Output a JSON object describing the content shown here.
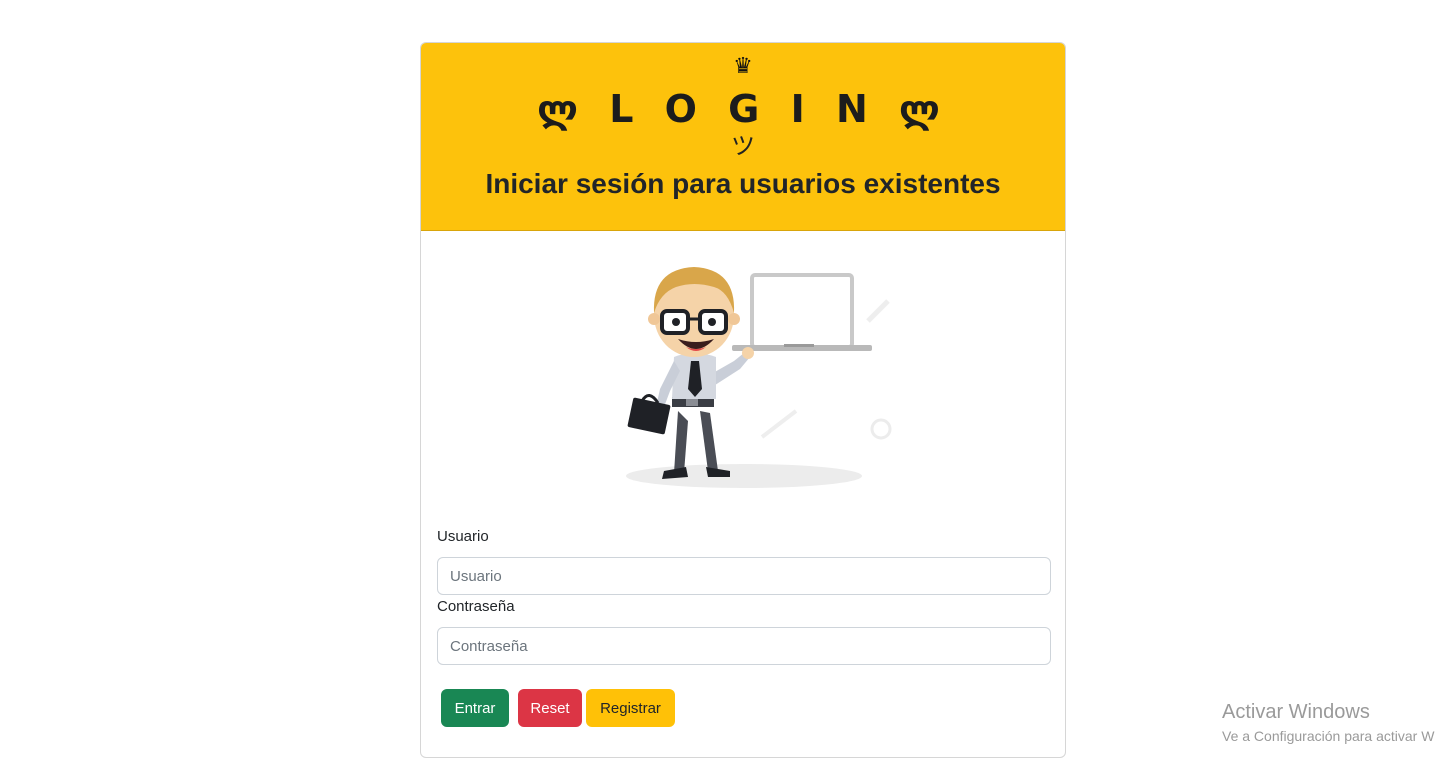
{
  "header": {
    "crown": "♛",
    "title": "ლ L O G I N ლ",
    "smiley": "ツ",
    "subtitle": "Iniciar sesión para usuarios existentes"
  },
  "illustration": {
    "icon": "businessman-with-laptop-illustration"
  },
  "form": {
    "username_label": "Usuario",
    "username_placeholder": "Usuario",
    "username_value": "",
    "password_label": "Contraseña",
    "password_placeholder": "Contraseña",
    "password_value": ""
  },
  "buttons": {
    "enter_label": "Entrar",
    "reset_label": "Reset",
    "register_label": "Registrar"
  },
  "colors": {
    "header_bg": "#fdc20c",
    "enter": "#198754",
    "reset": "#dc3545",
    "register": "#ffc107"
  },
  "watermark": {
    "title": "Activar Windows",
    "subtitle": "Ve a Configuración para activar W"
  }
}
